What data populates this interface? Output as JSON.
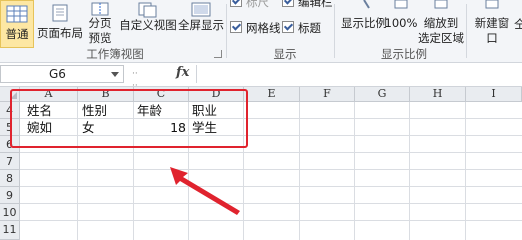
{
  "ribbon": {
    "view_buttons": [
      {
        "label": "普通",
        "active": true
      },
      {
        "label": "页面布局",
        "active": false
      },
      {
        "label": "分页预览",
        "line1": "分页",
        "line2": "预览",
        "active": false
      },
      {
        "label": "自定义视图",
        "active": false
      },
      {
        "label": "全屏显示",
        "active": false
      }
    ],
    "group_workbook_views": "工作簿视图",
    "show": {
      "ruler": {
        "label": "标尺",
        "checked": true
      },
      "formula_bar": {
        "label": "编辑栏",
        "checked": true
      },
      "gridlines": {
        "label": "网格线",
        "checked": true
      },
      "headings": {
        "label": "标题",
        "checked": true
      }
    },
    "group_show": "显示",
    "zoom_buttons": {
      "zoom": "显示比例",
      "hundred": "100%",
      "zoom_to_selection_line1": "缩放到",
      "zoom_to_selection_line2": "选定区域"
    },
    "group_zoom": "显示比例",
    "new_window": "新建窗口",
    "new_window_suffix": "仝"
  },
  "formula_bar": {
    "name_box": "G6",
    "fx": "fx",
    "value": ""
  },
  "grid": {
    "columns": [
      "A",
      "B",
      "C",
      "D",
      "E",
      "F",
      "G",
      "H",
      "I"
    ],
    "rows": [
      "4",
      "5",
      "6",
      "7",
      "8",
      "9",
      "10",
      "11"
    ],
    "cells": {
      "A4": "姓名",
      "B4": "性别",
      "C4": "年龄",
      "D4": "职业",
      "A5": "婉如",
      "B5": "女",
      "C5": "18",
      "D5": "学生"
    }
  },
  "annotation": {
    "box_color": "#e0232e",
    "arrow_color": "#e0232e"
  },
  "colors": {
    "active_view": "#fde7a3",
    "ribbon_bg": "#f3f5f8",
    "header_bg": "#e9ecf0"
  }
}
